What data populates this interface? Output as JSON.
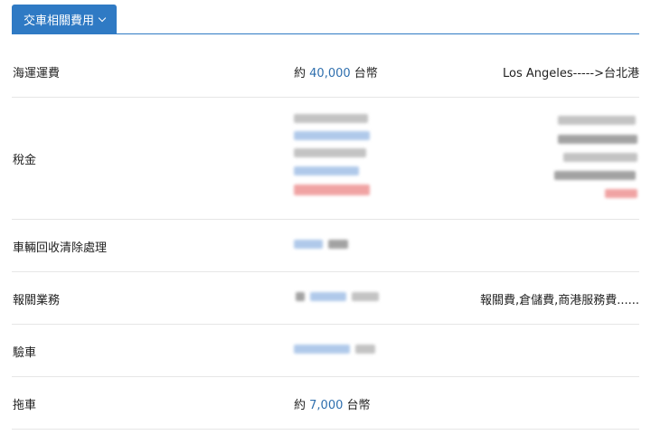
{
  "tab": {
    "label": "交車相關費用"
  },
  "rows": [
    {
      "name": "海運運費",
      "price_prefix": "約",
      "price_value": "40,000",
      "price_unit": "台幣",
      "note": "Los Angeles----->台北港"
    },
    {
      "name": "稅金"
    },
    {
      "name": "車輛回收清除處理"
    },
    {
      "name": "報關業務",
      "note": "報關費,倉儲費,商港服務費......"
    },
    {
      "name": "驗車"
    },
    {
      "name": "拖車",
      "price_prefix": "約",
      "price_value": "7,000",
      "price_unit": "台幣"
    }
  ]
}
